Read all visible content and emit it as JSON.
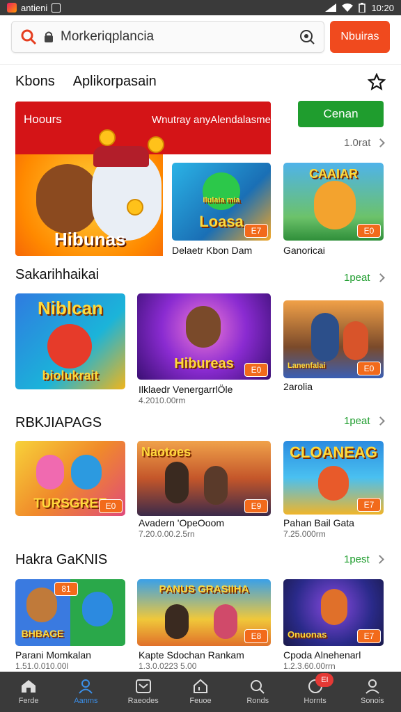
{
  "status_bar": {
    "app_name": "antieni",
    "time": "10:20"
  },
  "search": {
    "value": "Morkeriqplancia",
    "button_label": "Nbuiras"
  },
  "tabs": [
    {
      "label": "Kbons"
    },
    {
      "label": "Aplikorpasain"
    }
  ],
  "hero": {
    "cta": "Hoours",
    "tagline": "Wnutray anyAlendalasmes",
    "title": "Hibunas"
  },
  "cta_button": "Cenan",
  "featured": {
    "more_label": "1.0rat",
    "items": [
      {
        "art_title": "Loasa",
        "art_sub": "Ilulaia mia",
        "badge": "E7",
        "caption": "Delaetr Kbon Dam"
      },
      {
        "art_title": "CAAIAR",
        "badge": "E0",
        "caption": "Ganoricai"
      }
    ]
  },
  "sections": [
    {
      "title": "Sakarihhaikai",
      "more_label": "1peat",
      "items": [
        {
          "art_title": "Niblcan",
          "art_sub": "biolukrait",
          "caption": "",
          "sub": ""
        },
        {
          "art_title": "Hibureas",
          "badge": "E0",
          "caption": "Ilklaedr VenergarrlÖle",
          "sub": "4.2010.00rm"
        },
        {
          "art_title": "Lanenfalai",
          "badge": "E0",
          "caption": "2arolia",
          "sub": ""
        }
      ]
    },
    {
      "title": "RBKJIAPAGS",
      "more_label": "1peat",
      "items": [
        {
          "art_title": "TURSGREE",
          "badge": "E0",
          "caption": "",
          "sub": ""
        },
        {
          "art_title": "Naotoes",
          "badge": "E9",
          "caption": "Avadern 'OpeOoom",
          "sub": "7.20.0.00.2.5rn"
        },
        {
          "art_title": "CLOANEAG",
          "badge": "E7",
          "caption": "Pahan Bail Gata",
          "sub": "7.25.000rm"
        }
      ]
    },
    {
      "title": "Hakra GaKNIS",
      "more_label": "1pest",
      "items": [
        {
          "art_title": "BHBAGE",
          "badge": "81",
          "caption": "Parani Momkalan",
          "sub": "1.51.0.010.00l"
        },
        {
          "art_title": "PANUS GRASIIHA",
          "badge": "E8",
          "caption": "Kapte Sdochan Rankam",
          "sub": "1.3.0.0223 5.00"
        },
        {
          "art_title": "Onuonas",
          "badge": "E7",
          "caption": "Cpoda Alnehenarl",
          "sub": "1.2.3.60.00rrn"
        }
      ]
    }
  ],
  "nav": [
    {
      "label": "Ferde",
      "icon": "home-icon"
    },
    {
      "label": "Aanms",
      "icon": "person-icon"
    },
    {
      "label": "Raeodes",
      "icon": "inbox-icon"
    },
    {
      "label": "Feuoe",
      "icon": "home-outline-icon"
    },
    {
      "label": "Ronds",
      "icon": "search-icon"
    },
    {
      "label": "Hornts",
      "icon": "chat-icon",
      "badge": "EI"
    },
    {
      "label": "Sonois",
      "icon": "profile-icon"
    }
  ],
  "colors": {
    "accent_orange": "#f04a1e",
    "accent_green": "#1f9d2e",
    "nav_active": "#3b8fe8",
    "badge_orange": "#f26a1b"
  }
}
